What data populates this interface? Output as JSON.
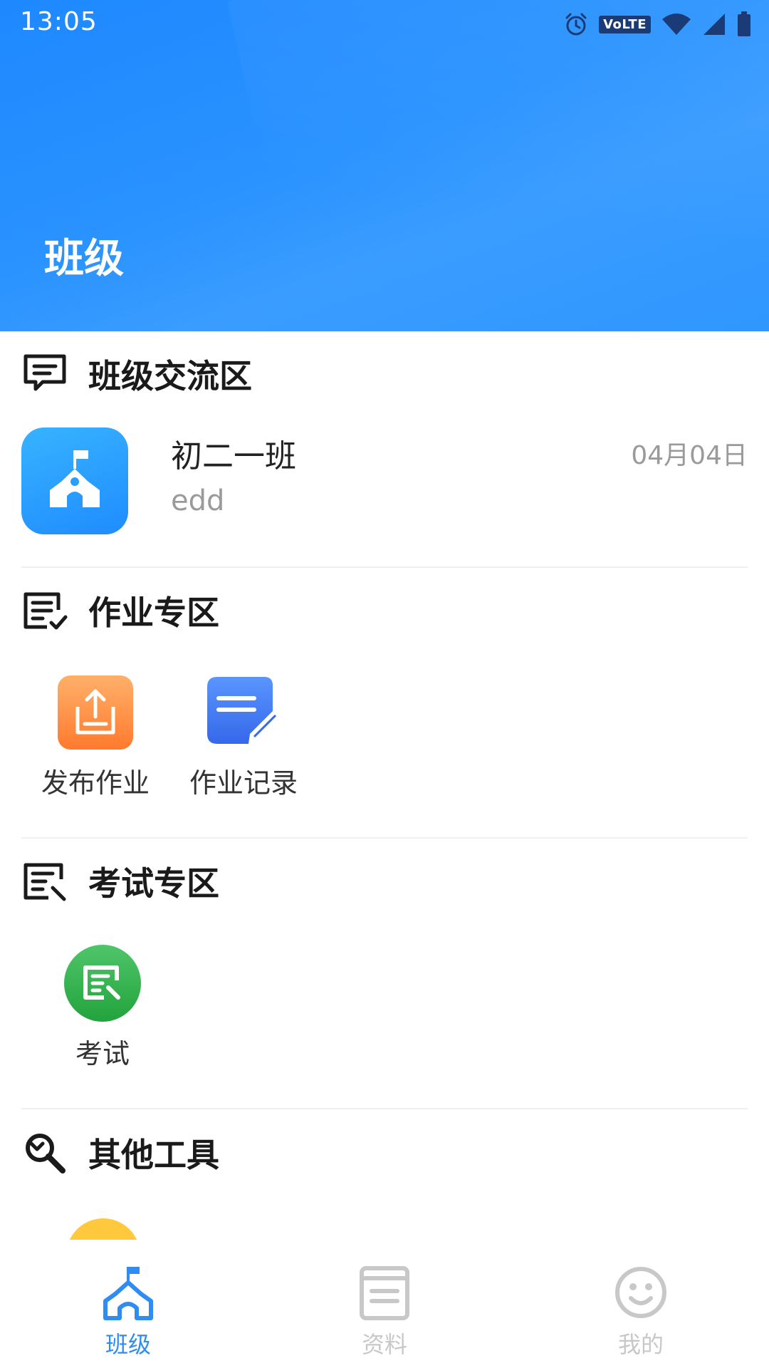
{
  "status_bar": {
    "time": "13:05",
    "icons": [
      "alarm-icon",
      "volte-icon",
      "wifi-icon",
      "signal-icon",
      "battery-icon"
    ],
    "volte_label": "VoLTE"
  },
  "header": {
    "title": "班级",
    "color": "#1e88ff"
  },
  "sections": {
    "chat": {
      "title": "班级交流区",
      "icon": "chat-bubble-icon",
      "items": [
        {
          "name": "初二一班",
          "last_message": "edd",
          "date": "04月04日",
          "avatar_icon": "school-icon"
        }
      ]
    },
    "homework": {
      "title": "作业专区",
      "icon": "homework-list-icon",
      "tools": [
        {
          "label": "发布作业",
          "icon": "upload-icon",
          "color": "#ff8a3d"
        },
        {
          "label": "作业记录",
          "icon": "note-edit-icon",
          "color": "#3f7cf5"
        }
      ]
    },
    "exam": {
      "title": "考试专区",
      "icon": "exam-icon",
      "tools": [
        {
          "label": "考试",
          "icon": "exam-search-icon",
          "color": "#2fae49"
        }
      ]
    },
    "other": {
      "title": "其他工具",
      "icon": "wrench-search-icon",
      "tools": [
        {
          "label": "",
          "icon": "partial-tool-icon",
          "color": "#ffc83d"
        }
      ]
    }
  },
  "tabbar": {
    "active_color": "#2e8cf2",
    "inactive_color": "#c8c8c8",
    "tabs": [
      {
        "label": "班级",
        "icon": "school-icon",
        "active": true
      },
      {
        "label": "资料",
        "icon": "book-icon",
        "active": false
      },
      {
        "label": "我的",
        "icon": "smiley-icon",
        "active": false
      }
    ]
  }
}
